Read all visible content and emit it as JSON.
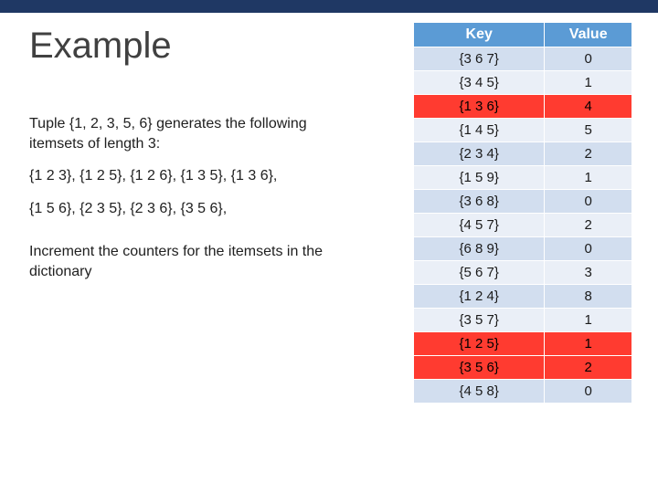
{
  "title": "Example",
  "body": {
    "p1": "Tuple {1, 2, 3, 5, 6} generates the following itemsets of length 3:",
    "p2": "{1 2 3}, {1 2 5}, {1 2 6}, {1 3 5}, {1 3 6},",
    "p3": "{1 5 6}, {2 3 5}, {2 3 6}, {3 5 6},",
    "p4": "Increment the counters for the itemsets in the dictionary"
  },
  "table": {
    "headers": {
      "key": "Key",
      "value": "Value"
    },
    "rows": [
      {
        "key": "{3 6 7}",
        "value": "0",
        "hl": false
      },
      {
        "key": "{3 4 5}",
        "value": "1",
        "hl": false
      },
      {
        "key": "{1 3 6}",
        "value": "4",
        "hl": true
      },
      {
        "key": "{1 4 5}",
        "value": "5",
        "hl": false
      },
      {
        "key": "{2 3 4}",
        "value": "2",
        "hl": false
      },
      {
        "key": "{1 5 9}",
        "value": "1",
        "hl": false
      },
      {
        "key": "{3 6 8}",
        "value": "0",
        "hl": false
      },
      {
        "key": "{4 5 7}",
        "value": "2",
        "hl": false
      },
      {
        "key": "{6 8 9}",
        "value": "0",
        "hl": false
      },
      {
        "key": "{5 6 7}",
        "value": "3",
        "hl": false
      },
      {
        "key": "{1 2 4}",
        "value": "8",
        "hl": false
      },
      {
        "key": "{3 5 7}",
        "value": "1",
        "hl": false
      },
      {
        "key": "{1 2 5}",
        "value": "1",
        "hl": true
      },
      {
        "key": "{3 5 6}",
        "value": "2",
        "hl": true
      },
      {
        "key": "{4 5 8}",
        "value": "0",
        "hl": false
      }
    ]
  },
  "chart_data": {
    "type": "table",
    "columns": [
      "Key",
      "Value"
    ],
    "rows": [
      [
        "{3 6 7}",
        0
      ],
      [
        "{3 4 5}",
        1
      ],
      [
        "{1 3 6}",
        4
      ],
      [
        "{1 4 5}",
        5
      ],
      [
        "{2 3 4}",
        2
      ],
      [
        "{1 5 9}",
        1
      ],
      [
        "{3 6 8}",
        0
      ],
      [
        "{4 5 7}",
        2
      ],
      [
        "{6 8 9}",
        0
      ],
      [
        "{5 6 7}",
        3
      ],
      [
        "{1 2 4}",
        8
      ],
      [
        "{3 5 7}",
        1
      ],
      [
        "{1 2 5}",
        1
      ],
      [
        "{3 5 6}",
        2
      ],
      [
        "{4 5 8}",
        0
      ]
    ],
    "highlighted_rows": [
      2,
      12,
      13
    ]
  }
}
